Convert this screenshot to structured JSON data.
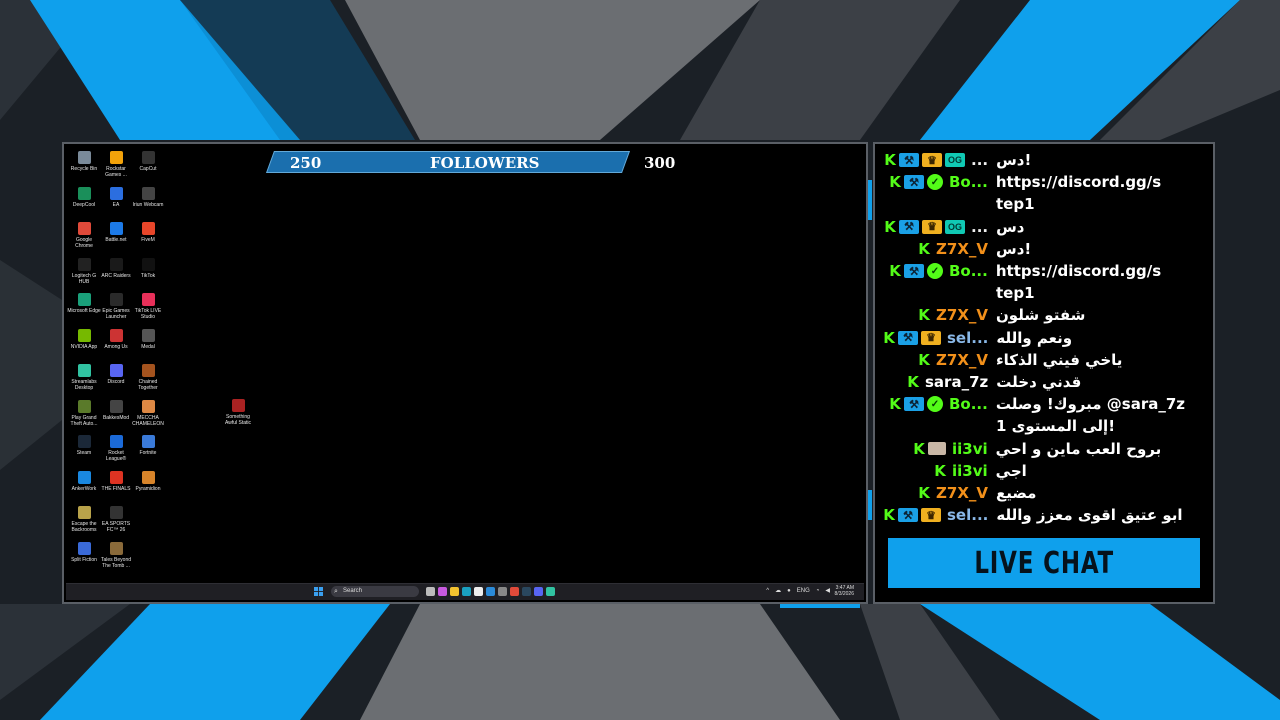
{
  "colors": {
    "accent_blue": "#0fa0ec",
    "kick_green": "#53fc18",
    "background": "#1b2026"
  },
  "followers": {
    "left_value": "250",
    "title": "FOLLOWERS",
    "right_value": "300"
  },
  "desktop_icons": [
    {
      "label": "Recycle Bin",
      "color": "#7a8a99",
      "icon": "recycle-bin-icon"
    },
    {
      "label": "Rockstar Games ...",
      "color": "#f2a20a",
      "icon": "rockstar-icon"
    },
    {
      "label": "CapCut",
      "color": "#333",
      "icon": "capcut-icon"
    },
    {
      "label": "DeepCool",
      "color": "#1a8f5a",
      "icon": "deepcool-icon"
    },
    {
      "label": "EA",
      "color": "#2b6ee0",
      "icon": "ea-icon"
    },
    {
      "label": "Iriun Webcam",
      "color": "#444",
      "icon": "webcam-icon"
    },
    {
      "label": "Google Chrome",
      "color": "#e04a3a",
      "icon": "chrome-icon"
    },
    {
      "label": "Battle.net",
      "color": "#1c7ae8",
      "icon": "battlenet-icon"
    },
    {
      "label": "FiveM",
      "color": "#e8462a",
      "icon": "fivem-icon"
    },
    {
      "label": "Logitech G HUB",
      "color": "#222",
      "icon": "ghub-icon"
    },
    {
      "label": "ARC Raiders",
      "color": "#1a1a1a",
      "icon": "arc-raiders-icon"
    },
    {
      "label": "TikTok",
      "color": "#111",
      "icon": "tiktok-icon"
    },
    {
      "label": "Microsoft Edge",
      "color": "#1aa07a",
      "icon": "edge-icon"
    },
    {
      "label": "Epic Games Launcher",
      "color": "#2a2a2a",
      "icon": "epic-icon"
    },
    {
      "label": "TikTok LIVE Studio",
      "color": "#e8305a",
      "icon": "tiktok-live-icon"
    },
    {
      "label": "NVIDIA App",
      "color": "#76b900",
      "icon": "nvidia-icon"
    },
    {
      "label": "Among Us",
      "color": "#c33",
      "icon": "among-us-icon"
    },
    {
      "label": "Medal",
      "color": "#555",
      "icon": "medal-icon"
    },
    {
      "label": "Streamlabs Desktop",
      "color": "#31c3a2",
      "icon": "streamlabs-icon"
    },
    {
      "label": "Discord",
      "color": "#5865f2",
      "icon": "discord-icon"
    },
    {
      "label": "Chained Together",
      "color": "#a4531e",
      "icon": "chained-icon"
    },
    {
      "label": "Play Grand Theft Auto...",
      "color": "#5a7a2a",
      "icon": "gta-icon"
    },
    {
      "label": "BakkesMod",
      "color": "#444",
      "icon": "bakkesmod-icon"
    },
    {
      "label": "MECCHA CHAMELEON",
      "color": "#d84",
      "icon": "meccha-icon"
    },
    {
      "label": "Steam",
      "color": "#1b2838",
      "icon": "steam-icon"
    },
    {
      "label": "Rocket League®",
      "color": "#1b6ad8",
      "icon": "rocket-league-icon"
    },
    {
      "label": "Fortnite",
      "color": "#3a7ad8",
      "icon": "fortnite-icon"
    },
    {
      "label": "AnkerWork",
      "color": "#1a88e0",
      "icon": "ankerwork-icon"
    },
    {
      "label": "THE FINALS",
      "color": "#d32",
      "icon": "the-finals-icon"
    },
    {
      "label": "Pyramidion",
      "color": "#d7842a",
      "icon": "pyramidion-icon"
    },
    {
      "label": "Escape the Backrooms",
      "color": "#b8a24a",
      "icon": "backrooms-icon"
    },
    {
      "label": "EA SPORTS FC™ 26",
      "color": "#333",
      "icon": "eafc-icon"
    },
    {
      "label": "",
      "color": "transparent",
      "icon": ""
    },
    {
      "label": "Split Fiction",
      "color": "#3a6ad8",
      "icon": "split-fiction-icon"
    },
    {
      "label": "Tales Beyond The Tomb ...",
      "color": "#8a6a3a",
      "icon": "tales-icon"
    }
  ],
  "lone_icon": {
    "label": "Something Awful Static",
    "color": "#a22",
    "icon": "something-awful-icon"
  },
  "taskbar": {
    "search_placeholder": "Search",
    "tray_lang": "ENG",
    "clock_time": "3:47 AM",
    "clock_date": "8/3/2026"
  },
  "chat_messages": [
    {
      "badges": [
        "kick",
        "mod",
        "vip",
        "og"
      ],
      "user": "...",
      "user_color": "#f0f0f0",
      "text": "دس!"
    },
    {
      "badges": [
        "kick",
        "mod",
        "verified"
      ],
      "user": "Bo...",
      "user_color": "#53fc18",
      "text": "https://discord.gg/s"
    },
    {
      "badges": [],
      "user": "",
      "user_color": "#fff",
      "text": "tep1"
    },
    {
      "badges": [
        "kick",
        "mod",
        "vip",
        "og"
      ],
      "user": "...",
      "user_color": "#f0f0f0",
      "text": "دس"
    },
    {
      "badges": [
        "kick"
      ],
      "user": "Z7X_V",
      "user_color": "#f2901a",
      "text": "دس!"
    },
    {
      "badges": [
        "kick",
        "mod",
        "verified"
      ],
      "user": "Bo...",
      "user_color": "#53fc18",
      "text": "https://discord.gg/s"
    },
    {
      "badges": [],
      "user": "",
      "user_color": "#fff",
      "text": "tep1"
    },
    {
      "badges": [
        "kick"
      ],
      "user": "Z7X_V",
      "user_color": "#f2901a",
      "text": "شفتو شلون"
    },
    {
      "badges": [
        "kick",
        "mod",
        "vip"
      ],
      "user": "sel...",
      "user_color": "#8ab8e8",
      "text": "ونعم والله"
    },
    {
      "badges": [
        "kick"
      ],
      "user": "Z7X_V",
      "user_color": "#f2901a",
      "text": "ياخي فيني الذكاء"
    },
    {
      "badges": [
        "kick"
      ],
      "user": "sara_7z",
      "user_color": "#ffffff",
      "text": "قدني دخلت"
    },
    {
      "badges": [
        "kick",
        "mod",
        "verified"
      ],
      "user": "Bo...",
      "user_color": "#53fc18",
      "text": "مبروك! وصلت @sara_7z"
    },
    {
      "badges": [],
      "user": "",
      "user_color": "#fff",
      "text": "إلى المستوى 1!"
    },
    {
      "badges": [
        "kick",
        "avatar"
      ],
      "user": "ii3vi",
      "user_color": "#53fc18",
      "text": "بروح العب ماين و احي"
    },
    {
      "badges": [
        "kick"
      ],
      "user": "ii3vi",
      "user_color": "#53fc18",
      "text": "اجي"
    },
    {
      "badges": [
        "kick"
      ],
      "user": "Z7X_V",
      "user_color": "#f2901a",
      "text": "مضيع"
    },
    {
      "badges": [
        "kick",
        "mod",
        "vip"
      ],
      "user": "sel...",
      "user_color": "#8ab8e8",
      "text": "ابو عتيق اقوى معزز والله"
    }
  ],
  "live_chat_label": "LIVE CHAT"
}
